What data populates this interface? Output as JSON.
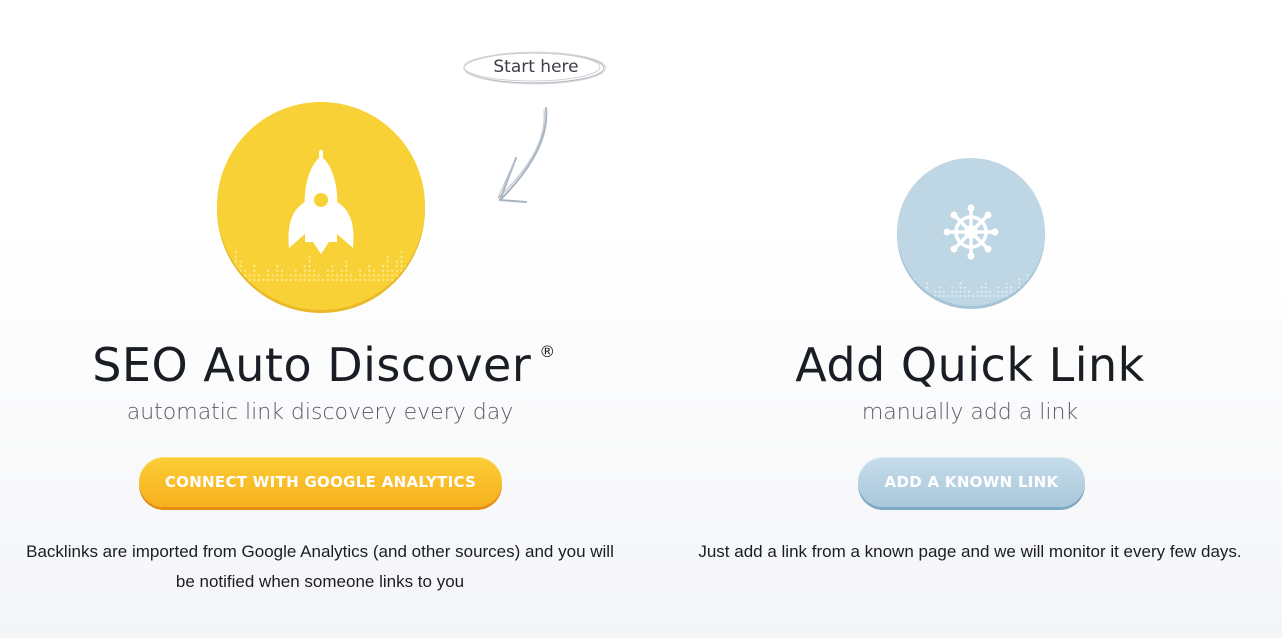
{
  "hint": {
    "text": "Start here"
  },
  "auto_discover": {
    "title": "SEO Auto Discover",
    "registered": "®",
    "subtitle": "automatic link discovery every day",
    "button_label": "CONNECT WITH GOOGLE ANALYTICS",
    "description": "Backlinks are imported from Google Analytics (and other sources) and you will be notified when someone links to you",
    "icon": "rocket-icon",
    "accent": "#f7d135"
  },
  "quick_link": {
    "title": "Add Quick Link",
    "subtitle": "manually add a link",
    "button_label": "ADD A KNOWN LINK",
    "description": "Just add a link from a known page and we will monitor it every few days.",
    "icon": "ship-wheel-icon",
    "accent": "#bfd7e5"
  }
}
